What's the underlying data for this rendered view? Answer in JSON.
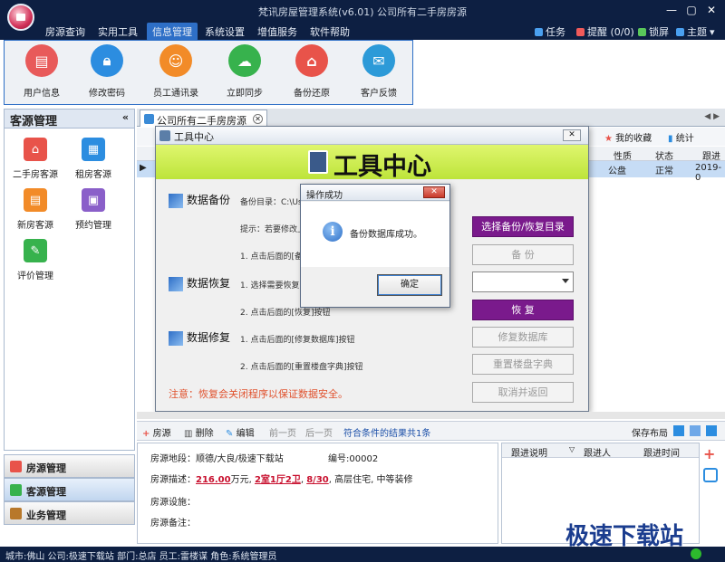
{
  "window": {
    "title": "梵讯房屋管理系统(v6.01) 公司所有二手房房源"
  },
  "menu": {
    "items": [
      "房源查询",
      "实用工具",
      "信息管理",
      "系统设置",
      "增值服务",
      "软件帮助"
    ],
    "active": "信息管理",
    "right": [
      "任务",
      "提醒 (0/0)",
      "锁屏",
      "主题"
    ]
  },
  "toolbar": {
    "buttons": [
      {
        "label": "用户信息",
        "color": "#e85a5a"
      },
      {
        "label": "修改密码",
        "color": "#2c8de0"
      },
      {
        "label": "员工通讯录",
        "color": "#f28b28"
      },
      {
        "label": "立即同步",
        "color": "#37b24d"
      },
      {
        "label": "备份还原",
        "color": "#e8534a"
      },
      {
        "label": "客户反馈",
        "color": "#2c9ad8"
      }
    ]
  },
  "left": {
    "title": "客源管理",
    "items": [
      {
        "label": "二手房客源",
        "color": "#e8534a"
      },
      {
        "label": "租房客源",
        "color": "#2c8de0"
      },
      {
        "label": "新房客源",
        "color": "#f28b28"
      },
      {
        "label": "预约管理",
        "color": "#8a5fc9"
      },
      {
        "label": "评价管理",
        "color": "#37b24d"
      }
    ],
    "nav": [
      "房源管理",
      "客源管理",
      "业务管理"
    ]
  },
  "tab": {
    "label": "公司所有二手房房源"
  },
  "grid": {
    "right_actions": [
      "我的收藏",
      "统计"
    ],
    "headers": [
      "性质",
      "状态",
      "跟进"
    ],
    "row": [
      "公盘",
      "正常",
      "2019-0"
    ]
  },
  "tool_dialog": {
    "title": "工具中心",
    "banner": "工具中心",
    "sections": [
      "数据备份",
      "数据恢复",
      "数据修复"
    ],
    "lines": [
      "备份目录：C:\\Us",
      "提示：若要修改上",
      "1. 点击后面的[备",
      "1. 选择需要恢复的",
      "2. 点击后面的[恢复]按钮",
      "1. 点击后面的[修复数据库]按钮",
      "2. 点击后面的[重置楼盘字典]按钮"
    ],
    "buttons": [
      "选择备份/恢复目录",
      "备 份",
      "恢 复",
      "修复数据库",
      "重置楼盘字典",
      "取消并返回"
    ],
    "warning": "注意：恢复会关闭程序以保证数据安全。"
  },
  "msg_dialog": {
    "title": "操作成功",
    "message": "备份数据库成功。",
    "ok": "确定"
  },
  "bottom_toolbar": {
    "items": [
      "房源",
      "删除",
      "编辑",
      "前一页",
      "后一页"
    ],
    "result": "符合条件的结果共1条",
    "save": "保存布局"
  },
  "detail": {
    "location_label": "房源地段：",
    "location": "顺德/大良/极速下载站",
    "id_label": "编号:",
    "id": "00002",
    "desc_label": "房源描述：",
    "price": "216.00",
    "price_unit": "万元,",
    "rooms": "2室1厅2卫",
    "floor": "8/30",
    "desc_tail": "高层住宅, 中等装修",
    "facility_label": "房源设施：",
    "remark_label": "房源备注："
  },
  "follow": {
    "headers": [
      "跟进说明",
      "跟进人",
      "跟进时间"
    ]
  },
  "status": {
    "text": "城市:佛山  公司:极速下载站  部门:总店  员工:雷楼谋  角色:系统管理员"
  },
  "watermark": "极速下载站"
}
